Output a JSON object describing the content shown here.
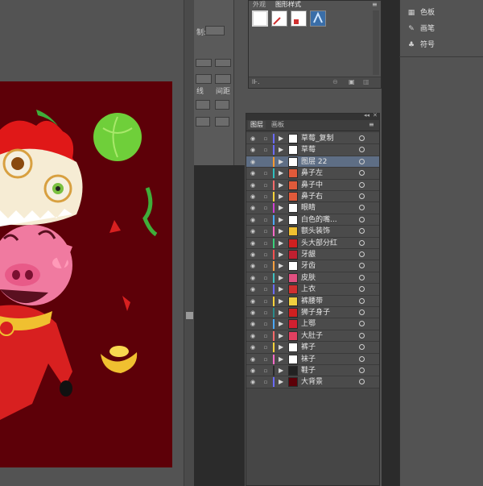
{
  "panels": {
    "graphic_styles": {
      "tabs": [
        "外观",
        "图形样式"
      ],
      "active_tab": 1
    },
    "layers": {
      "tabs": [
        "图层",
        "画板"
      ],
      "active_tab": 0,
      "rows": [
        {
          "name": "草莓_复制",
          "color": "#6a6aff",
          "thumb": "#ffffff",
          "selected": false,
          "locked": true
        },
        {
          "name": "草莓",
          "color": "#6a6aff",
          "thumb": "#ffffff",
          "selected": false,
          "locked": true
        },
        {
          "name": "图层 22",
          "color": "#ff9a2f",
          "thumb": "#ffffff",
          "selected": true,
          "locked": false
        },
        {
          "name": "鼻子左",
          "color": "#2fbfbf",
          "thumb": "#e05a3a",
          "selected": false,
          "locked": true
        },
        {
          "name": "鼻子中",
          "color": "#ff6a6a",
          "thumb": "#e05a3a",
          "selected": false,
          "locked": true
        },
        {
          "name": "鼻子右",
          "color": "#ffd23a",
          "thumb": "#e05a3a",
          "selected": false,
          "locked": true
        },
        {
          "name": "眼睛",
          "color": "#d040d0",
          "thumb": "#ffffff",
          "selected": false,
          "locked": true
        },
        {
          "name": "白色的嘴...",
          "color": "#4aa8ff",
          "thumb": "#ffffff",
          "selected": false,
          "locked": true
        },
        {
          "name": "额头装饰",
          "color": "#ff6ac8",
          "thumb": "#f0c030",
          "selected": false,
          "locked": true
        },
        {
          "name": "头大部分红",
          "color": "#3ad07a",
          "thumb": "#d02020",
          "selected": false,
          "locked": true
        },
        {
          "name": "牙龈",
          "color": "#ff5050",
          "thumb": "#c02030",
          "selected": false,
          "locked": true
        },
        {
          "name": "牙齿",
          "color": "#ffa040",
          "thumb": "#ffffff",
          "selected": false,
          "locked": true
        },
        {
          "name": "皮肤",
          "color": "#40c0c0",
          "thumb": "#e05080",
          "selected": false,
          "locked": true
        },
        {
          "name": "上衣",
          "color": "#6a6aff",
          "thumb": "#d03030",
          "selected": false,
          "locked": true
        },
        {
          "name": "裤腰带",
          "color": "#ffd23a",
          "thumb": "#f0d040",
          "selected": false,
          "locked": true
        },
        {
          "name": "狮子身子",
          "color": "#2a8a8a",
          "thumb": "#d02020",
          "selected": false,
          "locked": true
        },
        {
          "name": "上鄂",
          "color": "#4aa8ff",
          "thumb": "#d02030",
          "selected": false,
          "locked": true
        },
        {
          "name": "大肚子",
          "color": "#ff6a6a",
          "thumb": "#e04060",
          "selected": false,
          "locked": true
        },
        {
          "name": "裤子",
          "color": "#ffd23a",
          "thumb": "#ffffff",
          "selected": false,
          "locked": true
        },
        {
          "name": "袜子",
          "color": "#ff6ac8",
          "thumb": "#ffffff",
          "selected": false,
          "locked": true
        },
        {
          "name": "鞋子",
          "color": "#2a2a2a",
          "thumb": "#222222",
          "selected": false,
          "locked": true
        },
        {
          "name": "大背景",
          "color": "#6a6aff",
          "thumb": "#5d0008",
          "selected": false,
          "locked": true
        }
      ]
    },
    "right_dock": {
      "items": [
        {
          "label": "色板",
          "icon": "grid-icon"
        },
        {
          "label": "画笔",
          "icon": "brush-icon"
        },
        {
          "label": "符号",
          "icon": "club-icon"
        }
      ]
    },
    "property_strip": {
      "labels": [
        "制:",
        "线",
        "间距"
      ]
    }
  }
}
